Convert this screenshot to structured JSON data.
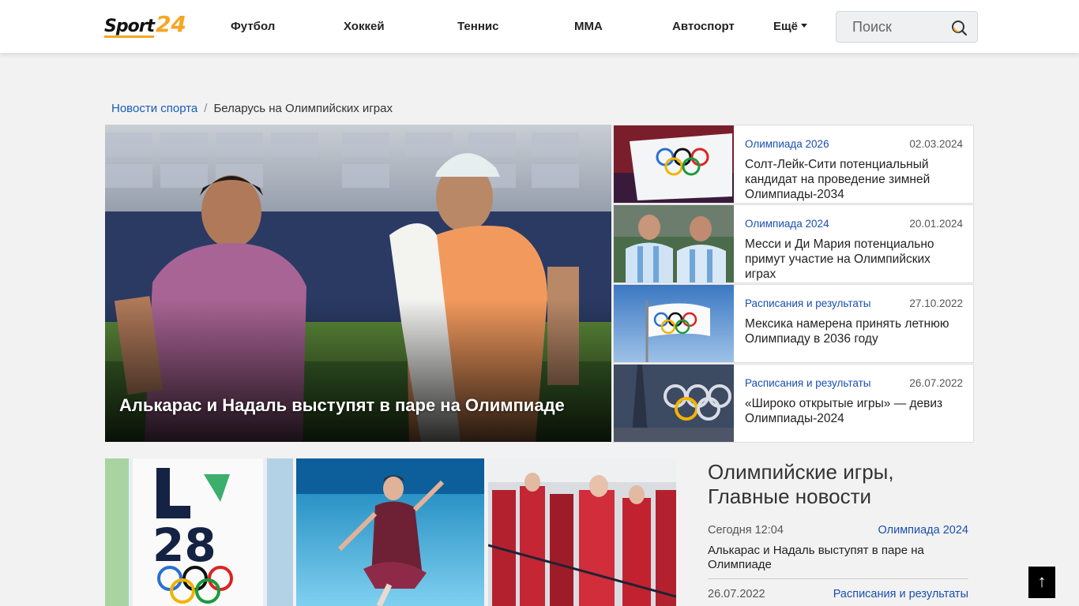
{
  "logo": {
    "part1": "Sport",
    "part2": "24"
  },
  "nav": {
    "items": [
      "Футбол",
      "Хоккей",
      "Теннис",
      "ММА",
      "Автоспорт"
    ],
    "more": "Ещё"
  },
  "search": {
    "placeholder": "Поиск"
  },
  "breadcrumb": {
    "home": "Новости спорта",
    "separator": "/",
    "current": "Беларусь на Олимпийских играх"
  },
  "hero": {
    "title": "Алькарас и Надаль выступят в паре на Олимпиаде"
  },
  "side_news": [
    {
      "category": "Олимпиада 2026",
      "date": "02.03.2024",
      "title": "Солт-Лейк-Сити потенциальный кандидат на проведение зимней Олимпиады-2034"
    },
    {
      "category": "Олимпиада 2024",
      "date": "20.01.2024",
      "title": "Месси и Ди Мария потенциально примут участие на Олимпийских играх"
    },
    {
      "category": "Расписания и результаты",
      "date": "27.10.2022",
      "title": "Мексика намерена принять летнюю Олимпиаду в 2036 году"
    },
    {
      "category": "Расписания и результаты",
      "date": "26.07.2022",
      "title": "«Широко открытые игры» — девиз Олимпиады-2024"
    }
  ],
  "main_news": {
    "title": "Олимпийские игры, Главные новости",
    "items": [
      {
        "time": "Сегодня 12:04",
        "category": "Олимпиада 2024",
        "title": "Алькарас и Надаль выступят в паре на Олимпиаде"
      },
      {
        "time": "26.07.2022",
        "category": "Расписания и результаты",
        "title": ""
      }
    ]
  },
  "to_top": {
    "label": "↑"
  },
  "colors": {
    "accent": "#f5a623",
    "link": "#1a4fb0",
    "background": "#f2f2f2"
  }
}
